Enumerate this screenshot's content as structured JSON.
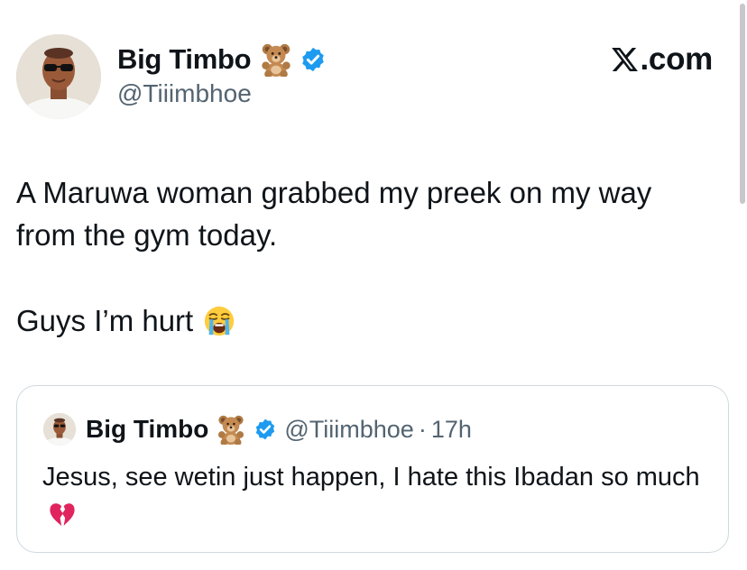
{
  "tweet": {
    "author": {
      "display_name": "Big Timbo",
      "handle": "@Tiiimbhoe",
      "emoji": "teddy-bear",
      "verified_icon": "verified-badge-icon",
      "verified_color": "#1d9bf0"
    },
    "brand": {
      "text": ".com",
      "logo": "x-logo-icon"
    },
    "text": {
      "line1": "A Maruwa woman grabbed my preek on my way",
      "line2": "from the gym today.",
      "line3": "Guys I’m hurt",
      "line3_emoji": "loudly-crying-face"
    }
  },
  "quoted_tweet": {
    "author": {
      "display_name": "Big Timbo",
      "handle": "@Tiiimbhoe",
      "emoji": "teddy-bear"
    },
    "separator": "·",
    "time": "17h",
    "text": "Jesus, see wetin just happen, I hate this Ibadan so much",
    "text_emoji": "broken-heart"
  },
  "colors": {
    "text": "#0f1419",
    "secondary": "#536471",
    "border": "#cfd9de",
    "accent": "#1d9bf0"
  }
}
